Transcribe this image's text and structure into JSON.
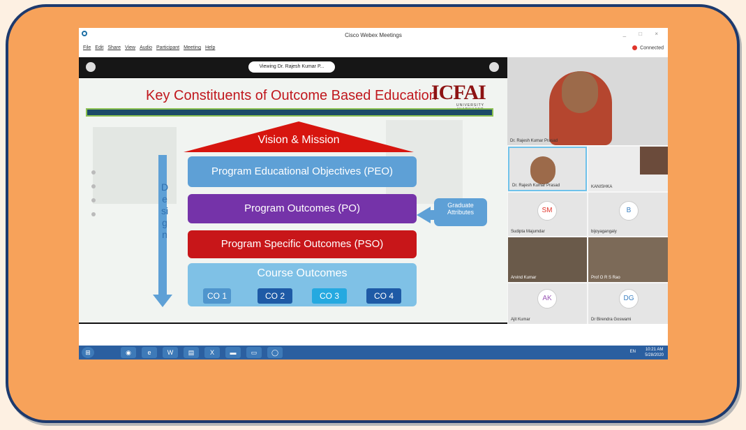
{
  "window": {
    "title": "Cisco Webex Meetings",
    "controls": "_ □ ×",
    "connection": "Connected"
  },
  "menu": [
    "File",
    "Edit",
    "Share",
    "View",
    "Audio",
    "Participant",
    "Meeting",
    "Help"
  ],
  "viewing_label": "Viewing Dr. Rajesh Kumar P...",
  "slide": {
    "title": "Key Constituents of Outcome Based Education",
    "brand": "ICFAI",
    "brand_sub": "UNIVERSITY JHARKHAND",
    "vision": "Vision & Mission",
    "peo": "Program Educational Objectives (PEO)",
    "po": "Program Outcomes (PO)",
    "pso": "Program Specific Outcomes (PSO)",
    "course_outcomes": "Course Outcomes",
    "co": [
      "CO 1",
      "CO 2",
      "CO 3",
      "CO 4"
    ],
    "graduate": "Graduate Attributes",
    "design": "Design"
  },
  "controls": {
    "mute": "mic-icon",
    "video": "video-icon",
    "share": "share-icon",
    "record": "record-icon",
    "participants": "participants-icon",
    "chat": "chat-icon",
    "more": "···",
    "end": "✕"
  },
  "participants": [
    {
      "name": "Dr. Rajesh Kumar Prasad"
    },
    {
      "name": "Dr. Rajesh Kumar Prasad"
    },
    {
      "name": "KANISHKA"
    },
    {
      "name": "Sudipta Majumdar",
      "initials": "SM"
    },
    {
      "name": "bijoyagangaly",
      "initials": "B"
    },
    {
      "name": "Arvind Kumar"
    },
    {
      "name": "Prof O R S Rao"
    },
    {
      "name": "Ajit Kumar",
      "initials": "AK"
    },
    {
      "name": "Dr Birendra Goswami",
      "initials": "DG"
    }
  ],
  "taskbar": {
    "lang": "EN",
    "time": "10:21 AM",
    "date": "5/28/2020"
  },
  "colors": {
    "frame": "#f7a25a",
    "border": "#1d3a6e",
    "peo": "#5ea0d6",
    "po": "#7533a9",
    "pso": "#c81619",
    "co_box": "#7fc1e6"
  }
}
